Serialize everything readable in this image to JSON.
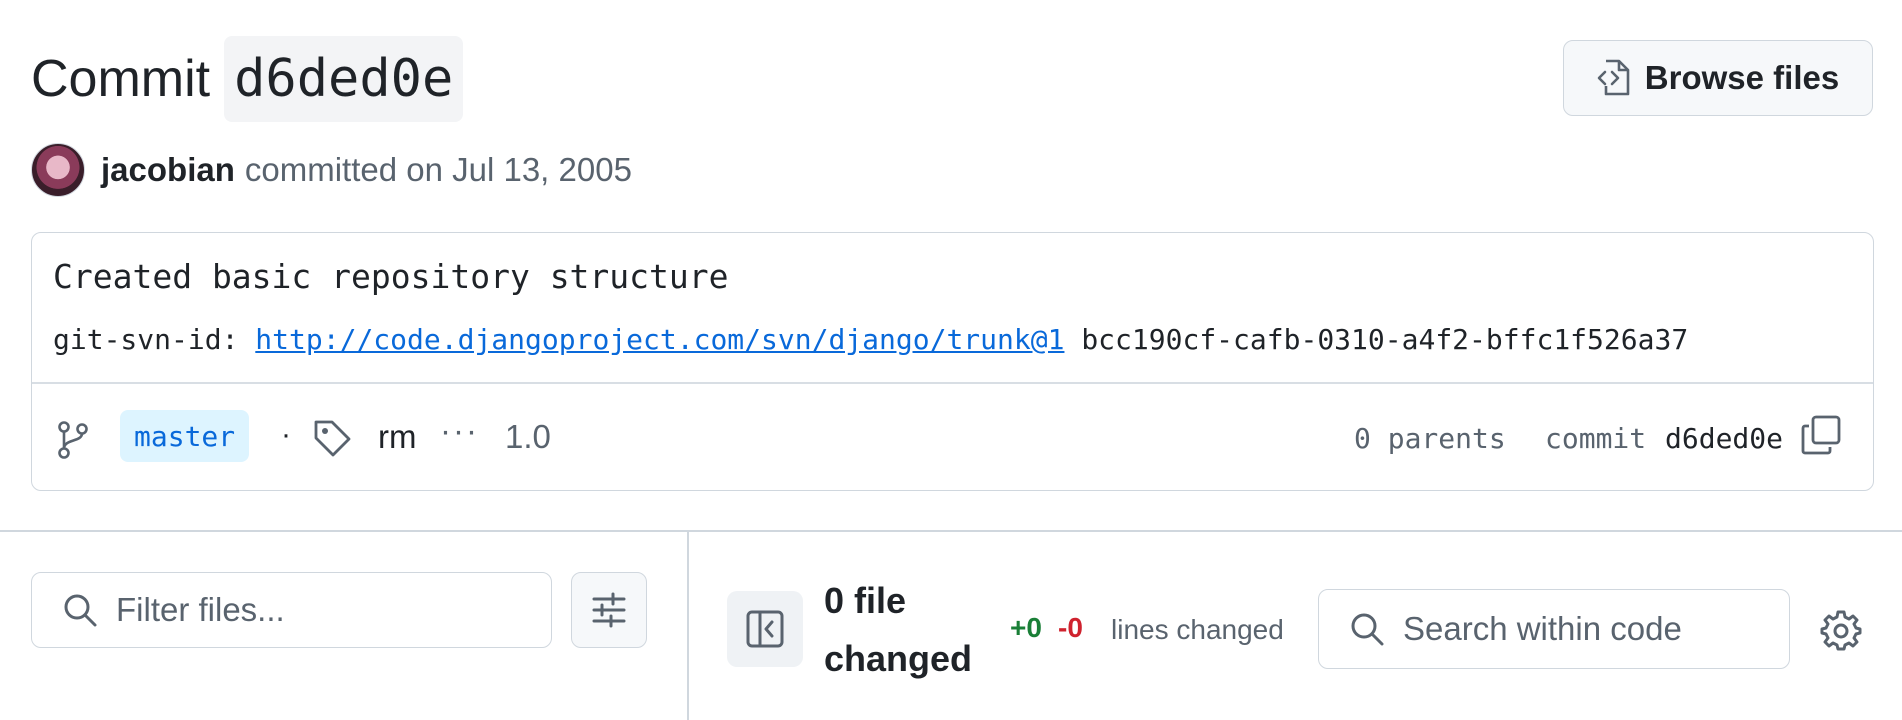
{
  "header": {
    "title_word": "Commit",
    "sha_short": "d6ded0e",
    "browse_button": "Browse files"
  },
  "author": {
    "name": "jacobian",
    "meta": "committed on Jul 13, 2005"
  },
  "commit": {
    "message_title": "Created basic repository structure",
    "body_prefix": "git-svn-id:",
    "body_link": "http://code.djangoproject.com/svn/django/trunk@1",
    "body_suffix": "bcc190cf-cafb-0310-a4f2-bffc1f526a37",
    "branch": "master",
    "dot_separator": "·",
    "tag": "rm",
    "more": "···",
    "version": "1.0",
    "parents": "0 parents",
    "commit_label": "commit",
    "commit_sha": "d6ded0e"
  },
  "files": {
    "filter_placeholder": "Filter files...",
    "changed_summary": "0 file changed",
    "additions": "+0",
    "deletions": "-0",
    "lines_changed_label": "lines changed",
    "search_placeholder": "Search within code"
  },
  "colors": {
    "accent": "#0969da",
    "addition": "#1a7f37",
    "deletion": "#cf222e",
    "border": "#d0d7de"
  },
  "icons": [
    "file-code-icon",
    "git-branch-icon",
    "tag-icon",
    "copy-icon",
    "search-icon",
    "filter-sliders-icon",
    "sidebar-collapse-icon",
    "gear-icon"
  ]
}
